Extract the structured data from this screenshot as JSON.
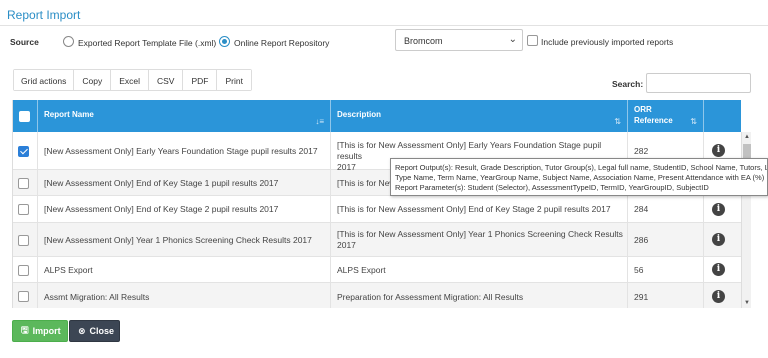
{
  "window": {
    "title": "Report Import"
  },
  "source": {
    "label": "Source",
    "options": [
      {
        "label": "Exported Report Template File (.xml)",
        "checked": false
      },
      {
        "label": "Online Report Repository",
        "checked": true
      }
    ],
    "repository_select": "Bromcom",
    "include_previous_label": "Include previously imported reports",
    "include_previous_checked": false
  },
  "grid_actions": {
    "label": "Grid actions",
    "buttons": [
      "Copy",
      "Excel",
      "CSV",
      "PDF",
      "Print"
    ]
  },
  "search": {
    "label": "Search:",
    "value": ""
  },
  "table": {
    "headers": {
      "name": "Report Name",
      "description": "Description",
      "orr_line1": "ORR",
      "orr_line2": "Reference"
    },
    "rows": [
      {
        "checked": true,
        "name": "[New Assessment Only] Early Years Foundation Stage pupil results 2017",
        "desc1": "[This is for New Assessment Only] Early Years Foundation Stage pupil results",
        "desc2": "2017",
        "orr": "282"
      },
      {
        "checked": false,
        "name": "[New Assessment Only] End of Key Stage 1 pupil results 2017",
        "desc1": "[This is for New",
        "desc2": "",
        "orr": ""
      },
      {
        "checked": false,
        "name": "[New Assessment Only] End of Key Stage 2 pupil results 2017",
        "desc1": "[This is for New Assessment Only] End of Key Stage 2 pupil results 2017",
        "desc2": "",
        "orr": "284"
      },
      {
        "checked": false,
        "name": "[New Assessment Only] Year 1 Phonics Screening Check Results 2017",
        "desc1": "[This is for New Assessment Only] Year 1 Phonics Screening Check Results",
        "desc2": "2017",
        "orr": "286"
      },
      {
        "checked": false,
        "name": "ALPS Export",
        "desc1": "ALPS Export",
        "desc2": "",
        "orr": "56"
      },
      {
        "checked": false,
        "name": "Assmt Migration: All Results",
        "desc1": "Preparation for Assessment Migration: All Results",
        "desc2": "",
        "orr": "291"
      }
    ]
  },
  "tooltip": {
    "line1": "Report Output(s): Result, Grade Description, Tutor Group(s), Legal full name, StudentID, School Name, Tutors, La",
    "line2": "Type Name, Term Name, YearGroup Name, Subject Name, Association Name, Present Attendance with EA (%)",
    "line3": "Report Parameter(s): Student (Selector), AssessmentTypeID, TermID, YearGroupID, SubjectID"
  },
  "footer": {
    "import_label": "Import",
    "close_label": "Close"
  },
  "colors": {
    "accent": "#2b95d9",
    "import": "#5cb85c",
    "close": "#3c4654"
  }
}
